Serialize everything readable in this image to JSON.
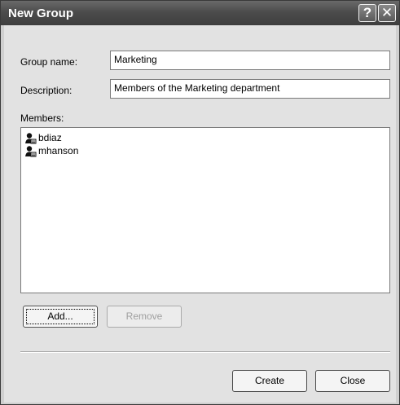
{
  "window": {
    "title": "New Group",
    "help_glyph": "?",
    "close_glyph": "✕"
  },
  "form": {
    "group_name_label": "Group name:",
    "group_name_value": "Marketing",
    "description_label": "Description:",
    "description_value": "Members of the Marketing department",
    "members_label": "Members:"
  },
  "members": [
    {
      "name": "bdiaz",
      "icon": "user-icon"
    },
    {
      "name": "mhanson",
      "icon": "user-icon"
    }
  ],
  "buttons": {
    "add": "Add...",
    "remove": "Remove",
    "create": "Create",
    "close": "Close"
  }
}
